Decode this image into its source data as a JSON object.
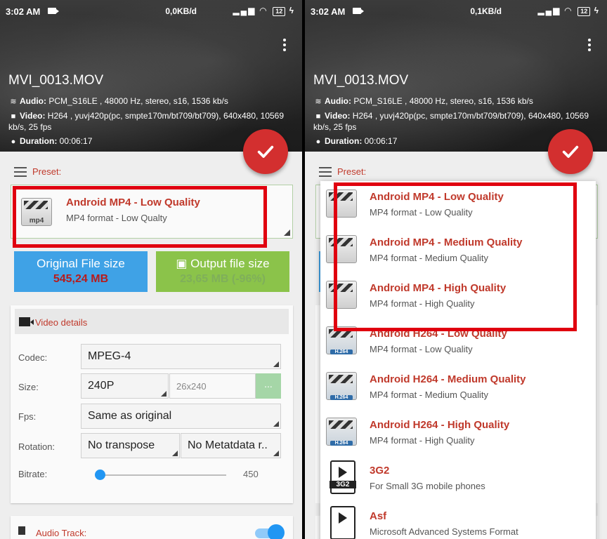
{
  "status_left": {
    "time": "3:02 AM",
    "speed": "0,0KB/d",
    "battery": "12"
  },
  "status_right": {
    "time": "3:02 AM",
    "speed": "0,1KB/d",
    "battery": "12"
  },
  "file": {
    "title": "MVI_0013.MOV",
    "audio_label": "Audio:",
    "audio_value": "PCM_S16LE , 48000 Hz, stereo, s16, 1536 kb/s",
    "video_label": "Video:",
    "video_value": "H264 , yuvj420p(pc, smpte170m/bt709/bt709), 640x480, 10569 kb/s, 25 fps",
    "duration_label": "Duration:",
    "duration_value": "00:06:17"
  },
  "preset": {
    "label": "Preset:",
    "selected_title": "Android MP4 - Low Quality",
    "selected_sub": "MP4 format - Low Qualty",
    "selected_icon_text": "mp4"
  },
  "sizes": {
    "original_label": "Original File size",
    "original_value": "545,24 MB",
    "output_label": "Output file size",
    "output_value": "23,65 MB (-96%)"
  },
  "video_details": {
    "title": "Video details",
    "codec_label": "Codec:",
    "codec_value": "MPEG-4",
    "size_label": "Size:",
    "size_value": "240P",
    "size_custom_placeholder": "26x240",
    "size_more": "...",
    "fps_label": "Fps:",
    "fps_value": "Same as original",
    "rotation_label": "Rotation:",
    "rotation_value": "No transpose",
    "metadata_value": "No Metatdata r..",
    "bitrate_label": "Bitrate:",
    "bitrate_value": "450"
  },
  "audio_track": {
    "label": "Audio Track:"
  },
  "dropdown": [
    {
      "title": "Android MP4 - Low Quality",
      "sub": "MP4 format - Low Quality",
      "icon": "clapper-mp4-icon"
    },
    {
      "title": "Android MP4 - Medium Quality",
      "sub": "MP4 format - Medium Quality",
      "icon": "clapper-mp4-icon"
    },
    {
      "title": "Android MP4 - High Quality",
      "sub": "MP4 format - High Quality",
      "icon": "clapper-mp4-icon"
    },
    {
      "title": "Android H264 - Low Quality",
      "sub": "MP4 format - Low Quality",
      "icon": "clapper-h264-icon",
      "icon_text": "H.264"
    },
    {
      "title": "Android H264 - Medium Quality",
      "sub": "MP4 format - Medium Quality",
      "icon": "clapper-h264-icon",
      "icon_text": "H.264"
    },
    {
      "title": "Android H264 - High Quality",
      "sub": "MP4 format - High Quality",
      "icon": "clapper-h264-icon",
      "icon_text": "H.264"
    },
    {
      "title": "3G2",
      "sub": "For Small 3G mobile phones",
      "icon": "3g2-file-icon",
      "icon_text": "3G2"
    },
    {
      "title": "Asf",
      "sub": "Microsoft Advanced Systems Format",
      "icon": "asf-file-icon"
    }
  ],
  "colors": {
    "accent_red": "#c0392b",
    "fab_red": "#d32f2f",
    "highlight_box": "#e0000f",
    "blue": "#3fa2e6",
    "green": "#8bc34a"
  }
}
